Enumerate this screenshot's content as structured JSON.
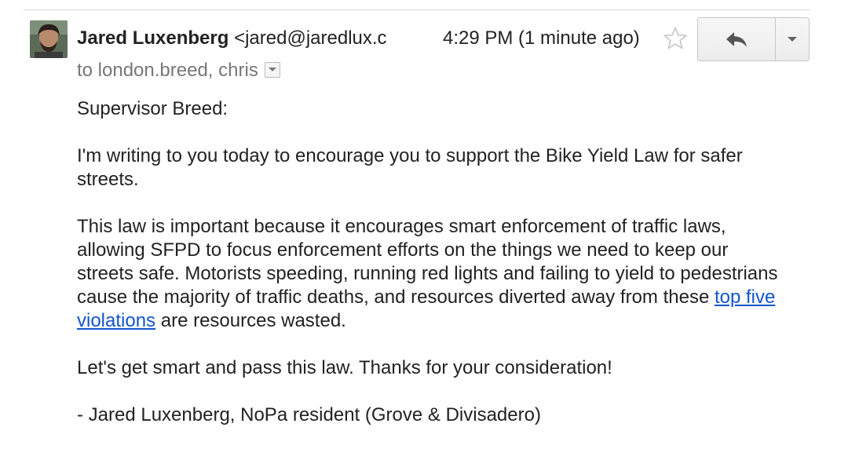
{
  "header": {
    "sender_name": "Jared Luxenberg",
    "sender_email": "<jared@jaredlux.c",
    "timestamp": "4:29 PM (1 minute ago)",
    "recipients": "to london.breed, chris"
  },
  "actions": {
    "star_icon": "star-outline-icon",
    "reply_icon": "reply-arrow-icon",
    "more_icon": "chevron-down-icon"
  },
  "body": {
    "greeting": "Supervisor Breed:",
    "paragraph1": "I'm writing to you today to encourage you to support the Bike Yield Law for safer streets.",
    "paragraph2_before_link": "This law is important because it encourages smart enforcement of traffic laws, allowing SFPD to focus enforcement efforts on the things we need to keep our streets safe. Motorists speeding, running red lights and failing to yield to pedestrians cause the majority of traffic deaths, and resources diverted away from these ",
    "link_text": "top five violations",
    "paragraph2_after_link": " are resources wasted.",
    "paragraph3": "Let's get smart and pass this law. Thanks for your consideration!",
    "signature": "- Jared Luxenberg, NoPa resident (Grove & Divisadero)"
  },
  "colors": {
    "link": "#1155cc",
    "meta_text": "#777777",
    "body_text": "#222222"
  }
}
